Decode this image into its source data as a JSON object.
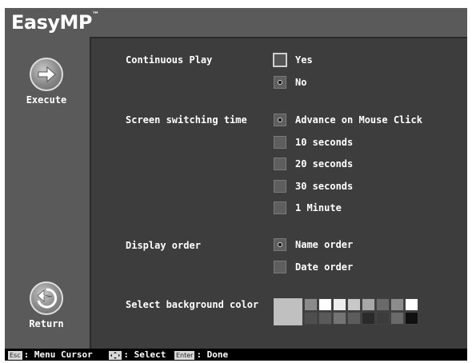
{
  "app": {
    "logo": "EasyMP",
    "tm": "™"
  },
  "sidebar": {
    "execute_label": "Execute",
    "return_label": "Return"
  },
  "settings": {
    "continuous_play": {
      "label": "Continuous Play",
      "options": [
        "Yes",
        "No"
      ],
      "selected": "No"
    },
    "screen_switching": {
      "label": "Screen switching time",
      "options": [
        "Advance on Mouse Click",
        "10 seconds",
        "20 seconds",
        "30 seconds",
        "1 Minute"
      ],
      "selected": "Advance on Mouse Click"
    },
    "display_order": {
      "label": "Display order",
      "options": [
        "Name order",
        "Date order"
      ],
      "selected": "Name order"
    },
    "background_color": {
      "label": "Select background color",
      "selected_color": "#c0c0c0",
      "palette_top": [
        "#8a8a8a",
        "#ffffff",
        "#ededed",
        "#c8c8c8",
        "#a8a8a8",
        "#6a6a6a",
        "#8c8c8c",
        "#ffffff"
      ],
      "palette_bottom": [
        "#4e4e4e",
        "#5a5a5a",
        "#747474",
        "#5c5c5c",
        "#2a2a2a",
        "#3c3c3c",
        "#6a6a6a",
        "#101010"
      ]
    }
  },
  "statusbar": {
    "esc_key": "Esc",
    "esc_text": ": Menu Cursor",
    "select_text": ": Select",
    "enter_key": "Enter",
    "enter_text": ": Done"
  },
  "colors": {
    "panel": "#3d3d3d",
    "frame": "#5a5a5a",
    "text": "#ffffff"
  }
}
